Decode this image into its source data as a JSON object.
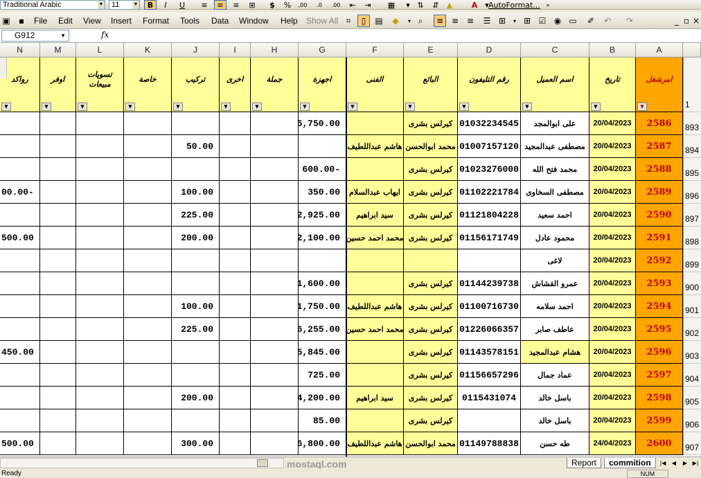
{
  "toolbar1": {
    "font_name": "Traditional Arabic",
    "font_size": "11",
    "bold": "B",
    "italic": "I",
    "underline": "U",
    "currency": "$",
    "percent": "%",
    "autoformat_label": "AutoFormat..."
  },
  "menu": {
    "items": [
      {
        "label": "File"
      },
      {
        "label": "Edit"
      },
      {
        "label": "View"
      },
      {
        "label": "Insert"
      },
      {
        "label": "Format"
      },
      {
        "label": "Tools"
      },
      {
        "label": "Data"
      },
      {
        "label": "Window"
      },
      {
        "label": "Help"
      }
    ],
    "show_all": "Show All"
  },
  "formula_bar": {
    "name_box": "G912",
    "fx": "fx"
  },
  "columns": [
    "N",
    "M",
    "L",
    "K",
    "J",
    "I",
    "H",
    "G",
    "F",
    "E",
    "D",
    "C",
    "B",
    "A"
  ],
  "header_row_number": "1",
  "headers": {
    "N": "رواكد",
    "M": "اوفر",
    "L": "تسويات مبيعات",
    "K": "خاصة",
    "J": "تركيب",
    "I": "اخرى",
    "H": "جملة",
    "G": "اجهزة",
    "F": "الفنى",
    "E": "البائع",
    "D": "رقم التليفون",
    "C": "اسم العميل",
    "B": "تاريخ",
    "A": "امرشغل"
  },
  "rows": [
    {
      "row": "893",
      "A": "2586",
      "B": "20/04/2023",
      "C": "على ابوالمجد",
      "D": "01032234545",
      "E": "كيرلس بشرى",
      "F": "",
      "G": "5,750.00",
      "J": "",
      "N": ""
    },
    {
      "row": "894",
      "A": "2587",
      "B": "20/04/2023",
      "C": "مصطفى عبدالمجيد",
      "D": "01007157120",
      "E": "محمد ابوالحسن",
      "F": "هاشم عبداللطيف",
      "G": "",
      "J": "50.00",
      "N": ""
    },
    {
      "row": "895",
      "A": "2588",
      "B": "20/04/2023",
      "C": "محمد فتح الله",
      "D": "01023276000",
      "E": "كيرلس بشرى",
      "F": "",
      "G": "600.00-",
      "J": "",
      "N": ""
    },
    {
      "row": "896",
      "A": "2589",
      "B": "20/04/2023",
      "C": "مصطفى السخاوى",
      "D": "01102221784",
      "E": "كيرلس بشرى",
      "F": "ايهاب عبدالسلام",
      "G": "350.00",
      "J": "100.00",
      "N": "00.00-"
    },
    {
      "row": "897",
      "A": "2590",
      "B": "20/04/2023",
      "C": "احمد سعيد",
      "D": "01121804228",
      "E": "كيرلس بشرى",
      "F": "سيد ابراهيم",
      "G": "2,925.00",
      "J": "225.00",
      "N": ""
    },
    {
      "row": "898",
      "A": "2591",
      "B": "20/04/2023",
      "C": "محمود عادل",
      "D": "01156171749",
      "E": "كيرلس بشرى",
      "F": "محمد احمد حسين",
      "G": "2,100.00",
      "J": "200.00",
      "N": "500.00"
    },
    {
      "row": "899",
      "A": "2592",
      "B": "20/04/2023",
      "C": "لاغى",
      "D": "",
      "E": "",
      "F": "",
      "G": "",
      "J": "",
      "N": ""
    },
    {
      "row": "900",
      "A": "2593",
      "B": "20/04/2023",
      "C": "عمرو القشاش",
      "D": "01144239738",
      "E": "كيرلس بشرى",
      "F": "",
      "G": "1,600.00",
      "J": "",
      "N": ""
    },
    {
      "row": "901",
      "A": "2594",
      "B": "20/04/2023",
      "C": "احمد سلامه",
      "D": "01100716730",
      "E": "كيرلس بشرى",
      "F": "هاشم عبداللطيف",
      "G": "1,750.00",
      "J": "100.00",
      "N": ""
    },
    {
      "row": "902",
      "A": "2595",
      "B": "20/04/2023",
      "C": "عاطف صابر",
      "D": "01226066357",
      "E": "كيرلس بشرى",
      "F": "محمد احمد حسين",
      "G": "6,255.00",
      "J": "225.00",
      "N": ""
    },
    {
      "row": "903",
      "A": "2596",
      "B": "20/04/2023",
      "C": "هشام عبدالمجيد",
      "D": "01143578151",
      "E": "كيرلس بشرى",
      "F": "",
      "G": "5,845.00",
      "J": "",
      "N": "450.00"
    },
    {
      "row": "904",
      "A": "2597",
      "B": "20/04/2023",
      "C": "عماد جمال",
      "D": "01156657296",
      "E": "كيرلس بشرى",
      "F": "",
      "G": "725.00",
      "J": "",
      "N": ""
    },
    {
      "row": "905",
      "A": "2598",
      "B": "20/04/2023",
      "C": "باسل خالد",
      "D": "0115431074",
      "E": "كيرلس بشرى",
      "F": "سيد ابراهيم",
      "G": "4,200.00",
      "J": "200.00",
      "N": ""
    },
    {
      "row": "906",
      "A": "2599",
      "B": "20/04/2023",
      "C": "باسل خالد",
      "D": "",
      "E": "كيرلس بشرى",
      "F": "",
      "G": "85.00",
      "J": "",
      "N": ""
    },
    {
      "row": "907",
      "A": "2600",
      "B": "24/04/2023",
      "C": "طه حسن",
      "D": "01149788838",
      "E": "محمد ابوالحسن",
      "F": "هاشم عبداللطيف",
      "G": "6,800.00",
      "J": "300.00",
      "N": "500.00"
    }
  ],
  "sheets": [
    {
      "label": "Report",
      "active": false
    },
    {
      "label": "commition",
      "active": true
    }
  ],
  "status": {
    "ready": "Ready",
    "num": "NUM"
  },
  "watermark": "mostaql.com"
}
